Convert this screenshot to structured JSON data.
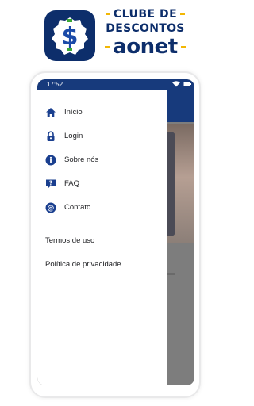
{
  "brand": {
    "line1": "CLUBE DE",
    "line2": "DESCONTOS",
    "line3": "aonet",
    "badge_symbol": "$",
    "colors": {
      "navy": "#0d2e6b",
      "accent_yellow": "#f2b705",
      "accent_green": "#3aa935",
      "badge_blue": "#1a4aa8"
    }
  },
  "statusbar": {
    "time": "17:52",
    "icons": [
      "wifi-icon",
      "battery-icon"
    ]
  },
  "menu": {
    "items": [
      {
        "label": "Início",
        "icon": "home-icon"
      },
      {
        "label": "Login",
        "icon": "lock-icon"
      },
      {
        "label": "Sobre nós",
        "icon": "info-icon"
      },
      {
        "label": "FAQ",
        "icon": "help-icon"
      },
      {
        "label": "Contato",
        "icon": "at-icon"
      }
    ],
    "links": [
      {
        "label": "Termos de uso"
      },
      {
        "label": "Política de privacidade"
      }
    ]
  }
}
